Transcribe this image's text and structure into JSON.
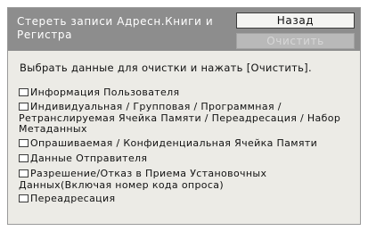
{
  "header": {
    "title": "Стереть записи Адресн.Книги и Регистра",
    "back_label": "Назад",
    "clear_label": "Очистить"
  },
  "instruction": "Выбрать данные для очистки и нажать [Очистить].",
  "options": [
    {
      "label": "Информация Пользователя",
      "checked": false
    },
    {
      "label": "Индивидуальная / Групповая / Программная / Ретранслируемая Ячейка Памяти / Переадресация / Набор Метаданных",
      "checked": false
    },
    {
      "label": "Опрашиваемая / Конфиденциальная Ячейка Памяти",
      "checked": false
    },
    {
      "label": "Данные Отправителя",
      "checked": false
    },
    {
      "label": "Разрешение/Отказ в Приема Установочных Данных(Включая номер кода опроса)",
      "checked": false
    },
    {
      "label": "Переадресация",
      "checked": false
    }
  ],
  "colors": {
    "header_bg": "#8d8d8d",
    "panel_bg": "#ecebe6",
    "disabled_button_bg": "#b9b9b9"
  }
}
